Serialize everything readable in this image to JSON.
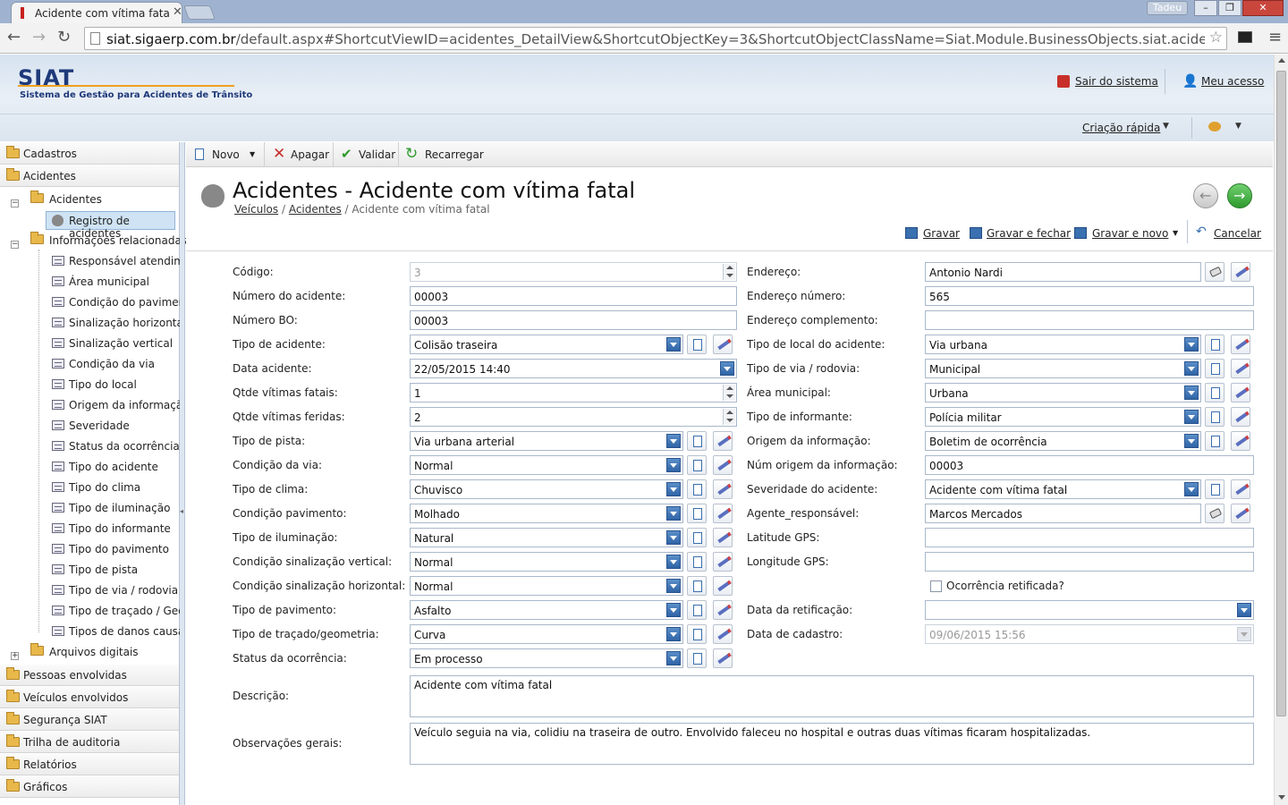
{
  "browser": {
    "tab_title": "Acidente com vítima fatal",
    "url_host": "siat.sigaerp.com.br",
    "url_path": "/default.aspx#ShortcutViewID=acidentes_DetailView&ShortcutObjectKey=3&ShortcutObjectClassName=Siat.Module.BusinessObjects.siat.acidentes&Shortc",
    "user_label": "Tadeu"
  },
  "header": {
    "logo": "SIAT",
    "subtitle": "Sistema de Gestão para Acidentes de Trânsito",
    "logout": "Sair do sistema",
    "my_access": "Meu acesso",
    "quick_create": "Criação rápida"
  },
  "sidebar": {
    "groups_top": [
      "Cadastros",
      "Acidentes"
    ],
    "tree_root": "Acidentes",
    "selected_item": "Registro de acidentes",
    "related_root": "Informações relacionadas",
    "related_items": [
      "Responsável atendimento",
      "Área municipal",
      "Condição do pavimento",
      "Sinalização horizontal",
      "Sinalização vertical",
      "Condição da via",
      "Tipo do local",
      "Origem da informação",
      "Severidade",
      "Status da ocorrência",
      "Tipo do acidente",
      "Tipo do clima",
      "Tipo de iluminação",
      "Tipo do informante",
      "Tipo do pavimento",
      "Tipo de pista",
      "Tipo de via / rodovia",
      "Tipo de traçado / Geometria",
      "Tipos de danos causados"
    ],
    "digital_files": "Arquivos digitais",
    "groups_bottom": [
      "Pessoas envolvidas",
      "Veículos envolvidos",
      "Segurança SIAT",
      "Trilha de auditoria",
      "Relatórios",
      "Gráficos"
    ]
  },
  "toolbar": {
    "new": "Novo",
    "delete": "Apagar",
    "validate": "Validar",
    "reload": "Recarregar"
  },
  "page": {
    "title": "Acidentes - Acidente com vítima fatal",
    "crumb1": "Veículos",
    "crumb2": "Acidentes",
    "crumb3": "Acidente com vítima fatal",
    "crumb_sep": "/"
  },
  "actions": {
    "save": "Gravar",
    "save_close": "Gravar e fechar",
    "save_new": "Gravar e novo",
    "cancel": "Cancelar"
  },
  "form_left": [
    {
      "label": "Código:",
      "value": "3"
    },
    {
      "label": "Número do acidente:",
      "value": "00003"
    },
    {
      "label": "Número BO:",
      "value": "00003"
    },
    {
      "label": "Tipo de acidente:",
      "value": "Colisão traseira"
    },
    {
      "label": "Data acidente:",
      "value": "22/05/2015 14:40"
    },
    {
      "label": "Qtde vítimas fatais:",
      "value": "1"
    },
    {
      "label": "Qtde vítimas feridas:",
      "value": "2"
    },
    {
      "label": "Tipo de pista:",
      "value": "Via urbana arterial"
    },
    {
      "label": "Condição da via:",
      "value": "Normal"
    },
    {
      "label": "Tipo de clima:",
      "value": "Chuvisco"
    },
    {
      "label": "Condição pavimento:",
      "value": "Molhado"
    },
    {
      "label": "Tipo de iluminação:",
      "value": "Natural"
    },
    {
      "label": "Condição sinalização vertical:",
      "value": "Normal"
    },
    {
      "label": "Condição sinalização horizontal:",
      "value": "Normal"
    },
    {
      "label": "Tipo de pavimento:",
      "value": "Asfalto"
    },
    {
      "label": "Tipo de traçado/geometria:",
      "value": "Curva"
    },
    {
      "label": "Status da ocorrência:",
      "value": "Em processo"
    }
  ],
  "form_right": [
    {
      "label": "Endereço:",
      "value": "Antonio Nardi"
    },
    {
      "label": "Endereço número:",
      "value": "565"
    },
    {
      "label": "Endereço complemento:",
      "value": ""
    },
    {
      "label": "Tipo de local do acidente:",
      "value": "Via urbana"
    },
    {
      "label": "Tipo de via / rodovia:",
      "value": "Municipal"
    },
    {
      "label": "Área municipal:",
      "value": "Urbana"
    },
    {
      "label": "Tipo de informante:",
      "value": "Polícia militar"
    },
    {
      "label": "Origem da informação:",
      "value": "Boletim de ocorrência"
    },
    {
      "label": "Núm origem da informação:",
      "value": "00003"
    },
    {
      "label": "Severidade do acidente:",
      "value": "Acidente com vítima fatal"
    },
    {
      "label": "Agente_responsável:",
      "value": "Marcos Mercados"
    },
    {
      "label": "Latitude GPS:",
      "value": ""
    },
    {
      "label": "Longitude GPS:",
      "value": ""
    },
    {
      "label": "Ocorrência retificada?",
      "value": ""
    },
    {
      "label": "Data da retificação:",
      "value": ""
    },
    {
      "label": "Data de cadastro:",
      "value": "09/06/2015 15:56"
    }
  ],
  "description": {
    "label": "Descrição:",
    "value": "Acidente com vítima fatal"
  },
  "notes": {
    "label": "Observações gerais:",
    "value": "Veículo seguia na via, colidiu na traseira de outro. Envolvido faleceu no hospital e outras duas vítimas ficaram hospitalizadas."
  },
  "colors": {
    "accent": "#2f63a5",
    "header_bg": "#d6e3f0",
    "brand": "#1f3a7a",
    "confirm": "#2e9a2e"
  }
}
